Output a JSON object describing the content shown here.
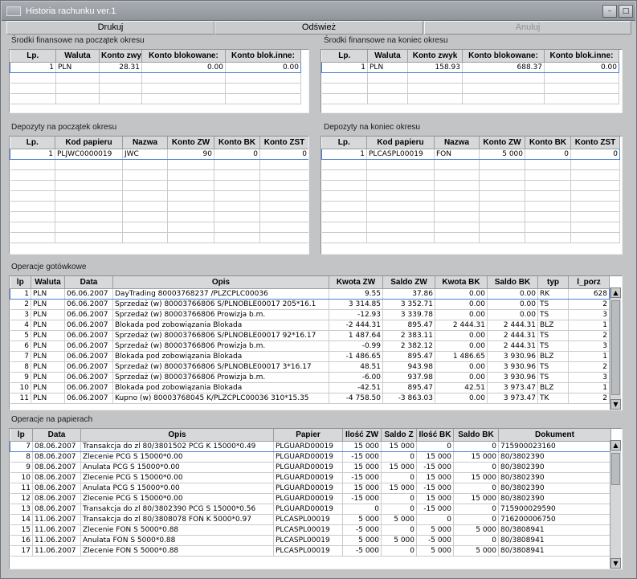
{
  "window": {
    "title": "Historia rachunku ver.1",
    "min_label": "–",
    "max_label": "□"
  },
  "toolbar": {
    "print_label": "Drukuj",
    "refresh_label": "Odśwież",
    "cancel_label": "Anuluj"
  },
  "funds_start": {
    "label": "Środki finansowe na początek okresu",
    "columns": [
      "Lp.",
      "Waluta",
      "Konto zwy",
      "Konto blokowane:",
      "Konto blok.inne:"
    ],
    "rows": [
      [
        "1",
        "PLN",
        "28.31",
        "0.00",
        "0.00"
      ]
    ]
  },
  "funds_end": {
    "label": "Środki finansowe na koniec okresu",
    "columns": [
      "Lp.",
      "Waluta",
      "Konto zwyk",
      "Konto blokowane:",
      "Konto blok.inne:"
    ],
    "rows": [
      [
        "1",
        "PLN",
        "158.93",
        "688.37",
        "0.00"
      ]
    ]
  },
  "deposits_start": {
    "label": "Depozyty na początek okresu",
    "columns": [
      "Lp.",
      "Kod papieru",
      "Nazwa",
      "Konto ZW",
      "Konto BK",
      "Konto ZST"
    ],
    "rows": [
      [
        "1",
        "PLJWC0000019",
        "JWC",
        "90",
        "0",
        "0"
      ]
    ]
  },
  "deposits_end": {
    "label": "Depozyty na koniec okresu",
    "columns": [
      "Lp.",
      "Kod papieru",
      "Nazwa",
      "Konto ZW",
      "Konto BK",
      "Konto ZST"
    ],
    "rows": [
      [
        "1",
        "PLCASPL00019",
        "FON",
        "5 000",
        "0",
        "0"
      ]
    ]
  },
  "cash_ops": {
    "label": "Operacje gotówkowe",
    "columns": [
      "lp",
      "Waluta",
      "Data",
      "Opis",
      "Kwota ZW",
      "Saldo ZW",
      "Kwota BK",
      "Saldo BK",
      "typ",
      "l_porz"
    ],
    "rows": [
      [
        "1",
        "PLN",
        "06.06.2007",
        "DayTrading 80003768237 /PLZCPLC00036",
        "9.55",
        "37.86",
        "0.00",
        "0.00",
        "RK",
        "628"
      ],
      [
        "2",
        "PLN",
        "06.06.2007",
        "Sprzedaż (w) 80003766806 S/PLNOBLE00017 205*16.1",
        "3 314.85",
        "3 352.71",
        "0.00",
        "0.00",
        "TS",
        "2"
      ],
      [
        "3",
        "PLN",
        "06.06.2007",
        "Sprzedaż (w) 80003766806 Prowizja b.m.",
        "-12.93",
        "3 339.78",
        "0.00",
        "0.00",
        "TS",
        "3"
      ],
      [
        "4",
        "PLN",
        "06.06.2007",
        "Blokada pod zobowiązania Blokada",
        "-2 444.31",
        "895.47",
        "2 444.31",
        "2 444.31",
        "BLZ",
        "1"
      ],
      [
        "5",
        "PLN",
        "06.06.2007",
        "Sprzedaż (w) 80003766806 S/PLNOBLE00017 92*16.17",
        "1 487.64",
        "2 383.11",
        "0.00",
        "2 444.31",
        "TS",
        "2"
      ],
      [
        "6",
        "PLN",
        "06.06.2007",
        "Sprzedaż (w) 80003766806 Prowizja b.m.",
        "-0.99",
        "2 382.12",
        "0.00",
        "2 444.31",
        "TS",
        "3"
      ],
      [
        "7",
        "PLN",
        "06.06.2007",
        "Blokada pod zobowiązania Blokada",
        "-1 486.65",
        "895.47",
        "1 486.65",
        "3 930.96",
        "BLZ",
        "1"
      ],
      [
        "8",
        "PLN",
        "06.06.2007",
        "Sprzedaż (w) 80003766806 S/PLNOBLE00017 3*16.17",
        "48.51",
        "943.98",
        "0.00",
        "3 930.96",
        "TS",
        "2"
      ],
      [
        "9",
        "PLN",
        "06.06.2007",
        "Sprzedaż (w) 80003766806 Prowizja b.m.",
        "-6.00",
        "937.98",
        "0.00",
        "3 930.96",
        "TS",
        "3"
      ],
      [
        "10",
        "PLN",
        "06.06.2007",
        "Blokada pod zobowiązania Blokada",
        "-42.51",
        "895.47",
        "42.51",
        "3 973.47",
        "BLZ",
        "1"
      ],
      [
        "11",
        "PLN",
        "06.06.2007",
        "Kupno (w) 80003768045 K/PLZCPLC00036 310*15.35",
        "-4 758.50",
        "-3 863.03",
        "0.00",
        "3 973.47",
        "TK",
        "2"
      ]
    ]
  },
  "paper_ops": {
    "label": "Operacje na papierach",
    "columns": [
      "lp",
      "Data",
      "Opis",
      "Papier",
      "Ilość ZW",
      "Saldo Z",
      "Ilość BK",
      "Saldo BK",
      "Dokument"
    ],
    "rows": [
      [
        "7",
        "08.06.2007",
        "Transakcja do zl 80/3801502 PCG K 15000*0.49",
        "PLGUARD00019",
        "15 000",
        "15 000",
        "0",
        "0",
        "715900023160"
      ],
      [
        "8",
        "08.06.2007",
        "Zlecenie PCG S 15000*0.00",
        "PLGUARD00019",
        "-15 000",
        "0",
        "15 000",
        "15 000",
        "80/3802390"
      ],
      [
        "9",
        "08.06.2007",
        "Anulata PCG S 15000*0.00",
        "PLGUARD00019",
        "15 000",
        "15 000",
        "-15 000",
        "0",
        "80/3802390"
      ],
      [
        "10",
        "08.06.2007",
        "Zlecenie PCG S 15000*0.00",
        "PLGUARD00019",
        "-15 000",
        "0",
        "15 000",
        "15 000",
        "80/3802390"
      ],
      [
        "11",
        "08.06.2007",
        "Anulata PCG S 15000*0.00",
        "PLGUARD00019",
        "15 000",
        "15 000",
        "-15 000",
        "0",
        "80/3802390"
      ],
      [
        "12",
        "08.06.2007",
        "Zlecenie PCG S 15000*0.00",
        "PLGUARD00019",
        "-15 000",
        "0",
        "15 000",
        "15 000",
        "80/3802390"
      ],
      [
        "13",
        "08.06.2007",
        "Transakcja do zl 80/3802390 PCG S 15000*0.56",
        "PLGUARD00019",
        "0",
        "0",
        "-15 000",
        "0",
        "715900029590"
      ],
      [
        "14",
        "11.06.2007",
        "Transakcja do zl 80/3808078 FON K 5000*0.97",
        "PLCASPL00019",
        "5 000",
        "5 000",
        "0",
        "0",
        "716200006750"
      ],
      [
        "15",
        "11.06.2007",
        "Zlecenie FON S 5000*0.88",
        "PLCASPL00019",
        "-5 000",
        "0",
        "5 000",
        "5 000",
        "80/3808941"
      ],
      [
        "16",
        "11.06.2007",
        "Anulata FON S 5000*0.88",
        "PLCASPL00019",
        "5 000",
        "5 000",
        "-5 000",
        "0",
        "80/3808941"
      ],
      [
        "17",
        "11.06.2007",
        "Zlecenie FON S 5000*0.88",
        "PLCASPL00019",
        "-5 000",
        "0",
        "5 000",
        "5 000",
        "80/3808941"
      ]
    ]
  }
}
